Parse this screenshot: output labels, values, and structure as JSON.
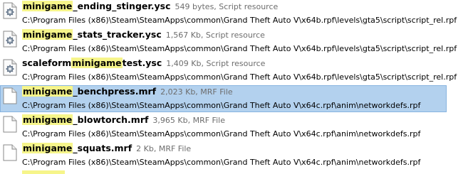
{
  "results": [
    {
      "name_pre": "",
      "name_hl": "minigame",
      "name_post": "_ending_stinger.ysc",
      "meta": "549 bytes, Script resource",
      "path": "C:\\Program Files (x86)\\Steam\\SteamApps\\common\\Grand Theft Auto V\\x64b.rpf\\levels\\gta5\\script\\script_rel.rpf",
      "icon": "script-gear-icon",
      "selected": false
    },
    {
      "name_pre": "",
      "name_hl": "minigame",
      "name_post": "_stats_tracker.ysc",
      "meta": "1,567 Kb, Script resource",
      "path": "C:\\Program Files (x86)\\Steam\\SteamApps\\common\\Grand Theft Auto V\\x64b.rpf\\levels\\gta5\\script\\script_rel.rpf",
      "icon": "script-gear-icon",
      "selected": false
    },
    {
      "name_pre": "scaleform",
      "name_hl": "minigame",
      "name_post": "test.ysc",
      "meta": "1,409 Kb, Script resource",
      "path": "C:\\Program Files (x86)\\Steam\\SteamApps\\common\\Grand Theft Auto V\\x64b.rpf\\levels\\gta5\\script\\script_rel.rpf",
      "icon": "script-gear-icon",
      "selected": false
    },
    {
      "name_pre": "",
      "name_hl": "minigame",
      "name_post": "_benchpress.mrf",
      "meta": "2,023 Kb, MRF File",
      "path": "C:\\Program Files (x86)\\Steam\\SteamApps\\common\\Grand Theft Auto V\\x64c.rpf\\anim\\networkdefs.rpf",
      "icon": "blank-file-icon",
      "selected": true
    },
    {
      "name_pre": "",
      "name_hl": "minigame",
      "name_post": "_blowtorch.mrf",
      "meta": "3,965 Kb, MRF File",
      "path": "C:\\Program Files (x86)\\Steam\\SteamApps\\common\\Grand Theft Auto V\\x64c.rpf\\anim\\networkdefs.rpf",
      "icon": "blank-file-icon",
      "selected": false
    },
    {
      "name_pre": "",
      "name_hl": "minigame",
      "name_post": "_squats.mrf",
      "meta": "2 Kb, MRF File",
      "path": "C:\\Program Files (x86)\\Steam\\SteamApps\\common\\Grand Theft Auto V\\x64c.rpf\\anim\\networkdefs.rpf",
      "icon": "blank-file-icon",
      "selected": false
    }
  ],
  "colors": {
    "highlight": "#f6f58a",
    "selection": "#b3d1ee",
    "meta_text": "#6d6d6d"
  }
}
